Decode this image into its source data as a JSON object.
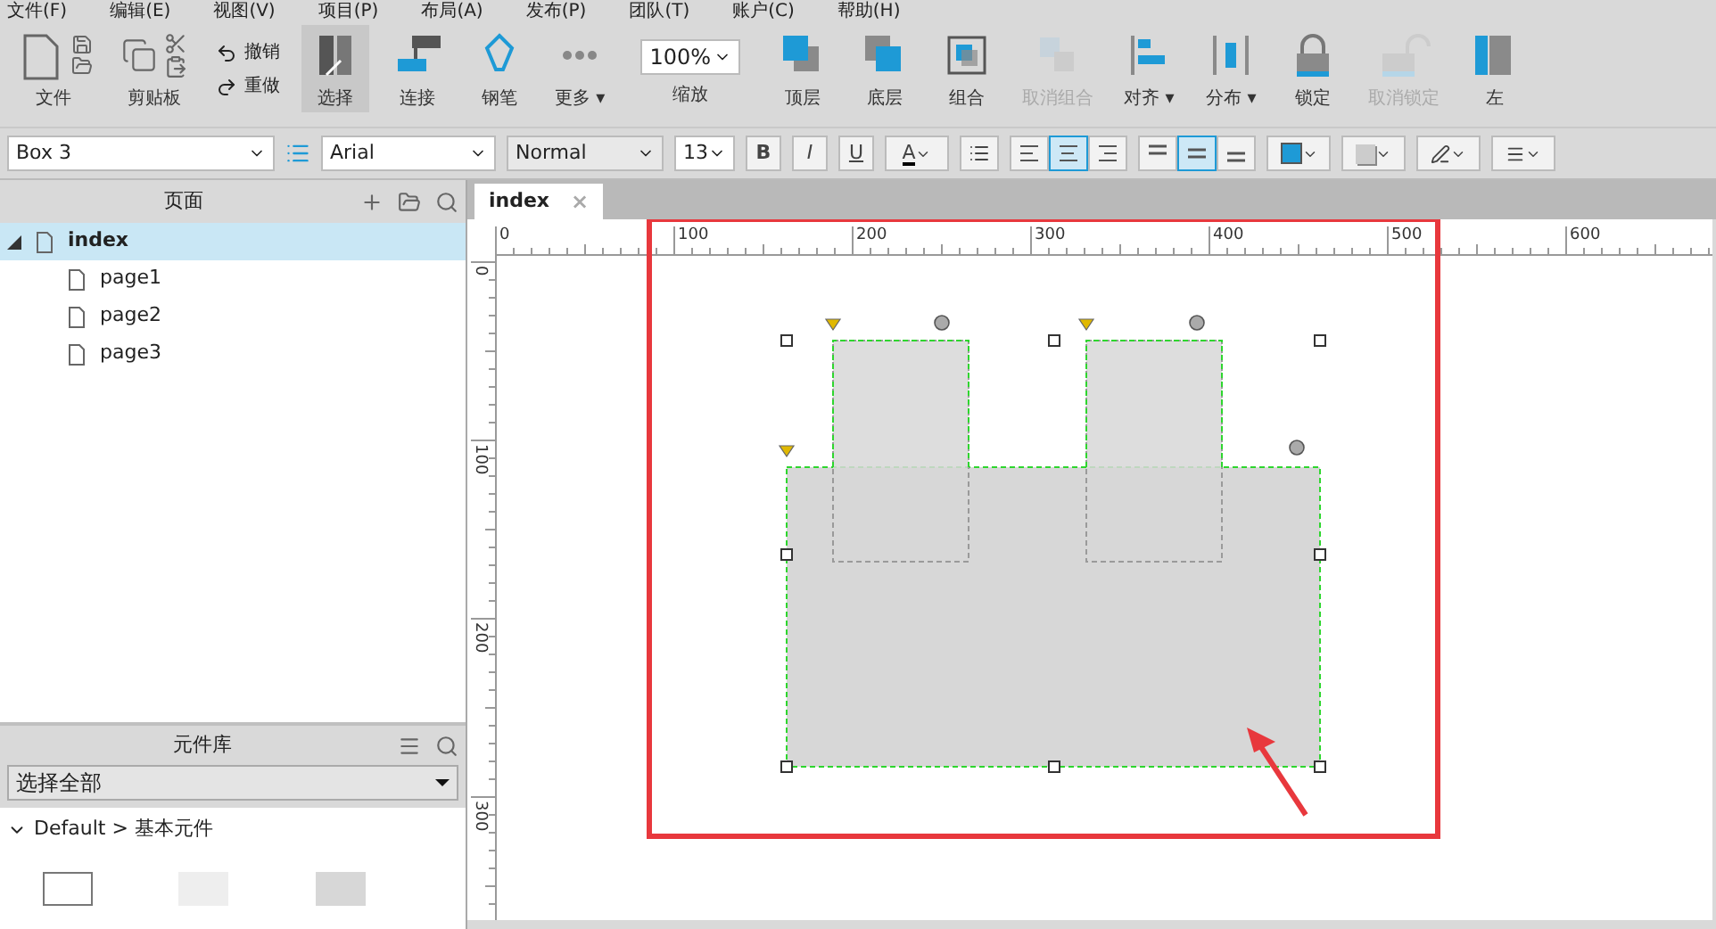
{
  "menu": [
    "文件(F)",
    "编辑(E)",
    "视图(V)",
    "项目(P)",
    "布局(A)",
    "发布(P)",
    "团队(T)",
    "账户(C)",
    "帮助(H)"
  ],
  "toolbar": [
    {
      "kind": "file",
      "label": "文件"
    },
    {
      "kind": "clipboard",
      "label": "剪贴板"
    },
    {
      "kind": "history",
      "items": [
        "撤销",
        "重做"
      ]
    },
    {
      "kind": "select",
      "label": "选择",
      "selected": true
    },
    {
      "kind": "connect",
      "label": "连接"
    },
    {
      "kind": "pen",
      "label": "钢笔"
    },
    {
      "kind": "more",
      "label": "更多 ▾"
    },
    {
      "kind": "zoom",
      "value": "100%",
      "label": "缩放"
    },
    {
      "kind": "front",
      "label": "顶层"
    },
    {
      "kind": "back",
      "label": "底层"
    },
    {
      "kind": "group",
      "label": "组合"
    },
    {
      "kind": "ungroup",
      "label": "取消组合",
      "disabled": true
    },
    {
      "kind": "align",
      "label": "对齐 ▾"
    },
    {
      "kind": "distribute",
      "label": "分布 ▾"
    },
    {
      "kind": "lock",
      "label": "锁定"
    },
    {
      "kind": "unlock",
      "label": "取消锁定",
      "disabled": true
    },
    {
      "kind": "left",
      "label": "左"
    }
  ],
  "format": {
    "widget_name": "Box 3",
    "font": "Arial",
    "style": "Normal",
    "size": "13",
    "bold": "B",
    "italic": "I",
    "underline": "U",
    "text_color": "A",
    "halign": [
      {
        "kind": "left",
        "selected": false
      },
      {
        "kind": "center",
        "selected": true
      },
      {
        "kind": "right",
        "selected": false
      }
    ],
    "valign": [
      {
        "kind": "top",
        "selected": false
      },
      {
        "kind": "middle",
        "selected": true
      },
      {
        "kind": "bottom",
        "selected": false
      }
    ]
  },
  "pages": {
    "title": "页面",
    "tree": [
      {
        "label": "index",
        "expanded": true,
        "selected": true,
        "children": [
          {
            "label": "page1",
            "selected": false
          },
          {
            "label": "page2",
            "selected": false
          },
          {
            "label": "page3",
            "selected": false
          }
        ]
      }
    ]
  },
  "library": {
    "title": "元件库",
    "filter": "选择全部",
    "section": {
      "label": "Default > 基本元件",
      "expanded": true
    }
  },
  "tabs": [
    {
      "label": "index",
      "selected": true,
      "close": "×"
    }
  ],
  "rulers": {
    "horizontal": [
      "0",
      "100",
      "200",
      "300",
      "400",
      "500",
      "600"
    ],
    "vertical": [
      "0",
      "100",
      "200",
      "300"
    ]
  }
}
